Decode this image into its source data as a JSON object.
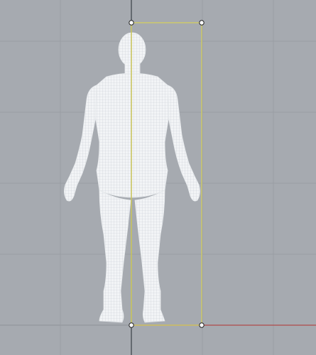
{
  "viewport": {
    "view": "front",
    "background_color": "#a6aab0",
    "grid_color": "#9a9ea4",
    "grid_major_color": "#8f9399",
    "axis_y_color": "#3a3f45",
    "axis_x_color": "#b04a4a",
    "mesh_color": "#f2f4f6",
    "mesh_line_color": "#c9ced4",
    "bounding_box_color": "#d8d25a",
    "grip_fill": "#ffffff",
    "grip_stroke": "#222222",
    "object": "human-figure-wireframe-mesh",
    "selection": "bounding-box-with-grips"
  }
}
